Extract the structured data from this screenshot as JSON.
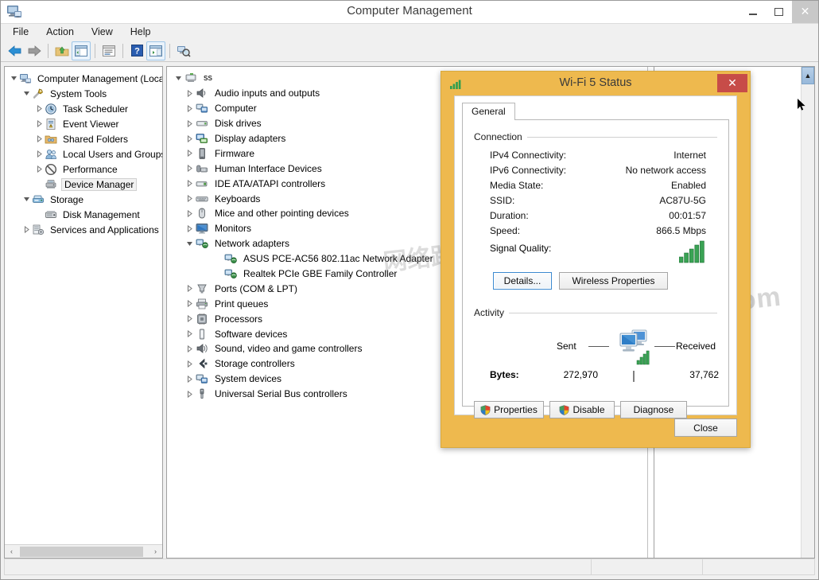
{
  "window": {
    "title": "Computer Management",
    "app_icon": "computer-management-icon",
    "controls": {
      "minimize": "–",
      "maximize": "☐",
      "close": "✕"
    }
  },
  "menubar": {
    "items": [
      "File",
      "Action",
      "View",
      "Help"
    ]
  },
  "toolbar": {
    "buttons": [
      {
        "name": "back-icon"
      },
      {
        "name": "forward-icon"
      },
      {
        "name": "up-folder-icon"
      },
      {
        "name": "show-console-tree-icon"
      },
      {
        "name": "properties-icon"
      },
      {
        "name": "help-icon"
      },
      {
        "name": "show-action-pane-icon"
      },
      {
        "name": "scan-hardware-changes-icon"
      }
    ]
  },
  "sidebar": {
    "items": [
      {
        "label": "Computer Management (Local",
        "indent": 0,
        "expander": "open",
        "icon": "computer-management-icon",
        "selected": false
      },
      {
        "label": "System Tools",
        "indent": 1,
        "expander": "open",
        "icon": "system-tools-icon",
        "selected": false
      },
      {
        "label": "Task Scheduler",
        "indent": 2,
        "expander": "closed",
        "icon": "clock-icon",
        "selected": false
      },
      {
        "label": "Event Viewer",
        "indent": 2,
        "expander": "closed",
        "icon": "event-viewer-icon",
        "selected": false
      },
      {
        "label": "Shared Folders",
        "indent": 2,
        "expander": "closed",
        "icon": "shared-folders-icon",
        "selected": false
      },
      {
        "label": "Local Users and Groups",
        "indent": 2,
        "expander": "closed",
        "icon": "users-icon",
        "selected": false
      },
      {
        "label": "Performance",
        "indent": 2,
        "expander": "closed",
        "icon": "performance-icon",
        "selected": false
      },
      {
        "label": "Device Manager",
        "indent": 2,
        "expander": "none",
        "icon": "device-manager-icon",
        "selected": true
      },
      {
        "label": "Storage",
        "indent": 1,
        "expander": "open",
        "icon": "storage-icon",
        "selected": false
      },
      {
        "label": "Disk Management",
        "indent": 2,
        "expander": "none",
        "icon": "disk-management-icon",
        "selected": false
      },
      {
        "label": "Services and Applications",
        "indent": 1,
        "expander": "closed",
        "icon": "services-icon",
        "selected": false
      }
    ]
  },
  "device_tree": {
    "root": {
      "label": "ss",
      "expander": "open",
      "icon": "computer-node-icon"
    },
    "items": [
      {
        "label": "Audio inputs and outputs",
        "level": 2,
        "expander": "closed",
        "icon": "audio-icon"
      },
      {
        "label": "Computer",
        "level": 2,
        "expander": "closed",
        "icon": "computer-icon"
      },
      {
        "label": "Disk drives",
        "level": 2,
        "expander": "closed",
        "icon": "disk-drive-icon"
      },
      {
        "label": "Display adapters",
        "level": 2,
        "expander": "closed",
        "icon": "display-adapter-icon"
      },
      {
        "label": "Firmware",
        "level": 2,
        "expander": "closed",
        "icon": "firmware-icon"
      },
      {
        "label": "Human Interface Devices",
        "level": 2,
        "expander": "closed",
        "icon": "hid-icon"
      },
      {
        "label": "IDE ATA/ATAPI controllers",
        "level": 2,
        "expander": "closed",
        "icon": "ide-controller-icon"
      },
      {
        "label": "Keyboards",
        "level": 2,
        "expander": "closed",
        "icon": "keyboard-icon"
      },
      {
        "label": "Mice and other pointing devices",
        "level": 2,
        "expander": "closed",
        "icon": "mouse-icon"
      },
      {
        "label": "Monitors",
        "level": 2,
        "expander": "closed",
        "icon": "monitor-icon"
      },
      {
        "label": "Network adapters",
        "level": 2,
        "expander": "open",
        "icon": "network-adapter-icon"
      },
      {
        "label": "ASUS PCE-AC56 802.11ac Network Adapter",
        "level": 3,
        "expander": "none",
        "icon": "network-adapter-icon"
      },
      {
        "label": "Realtek PCIe GBE Family Controller",
        "level": 3,
        "expander": "none",
        "icon": "network-adapter-icon"
      },
      {
        "label": "Ports (COM & LPT)",
        "level": 2,
        "expander": "closed",
        "icon": "port-icon"
      },
      {
        "label": "Print queues",
        "level": 2,
        "expander": "closed",
        "icon": "printer-icon"
      },
      {
        "label": "Processors",
        "level": 2,
        "expander": "closed",
        "icon": "processor-icon"
      },
      {
        "label": "Software devices",
        "level": 2,
        "expander": "closed",
        "icon": "software-device-icon"
      },
      {
        "label": "Sound, video and game controllers",
        "level": 2,
        "expander": "closed",
        "icon": "sound-icon"
      },
      {
        "label": "Storage controllers",
        "level": 2,
        "expander": "closed",
        "icon": "storage-controller-icon"
      },
      {
        "label": "System devices",
        "level": 2,
        "expander": "closed",
        "icon": "system-device-icon"
      },
      {
        "label": "Universal Serial Bus controllers",
        "level": 2,
        "expander": "closed",
        "icon": "usb-icon"
      }
    ]
  },
  "dialog": {
    "title": "Wi-Fi 5 Status",
    "icon": "wifi-signal-icon",
    "close_glyph": "✕",
    "tab": "General",
    "connection": {
      "group_label": "Connection",
      "rows": [
        {
          "key": "IPv4 Connectivity:",
          "value": "Internet"
        },
        {
          "key": "IPv6 Connectivity:",
          "value": "No network access"
        },
        {
          "key": "Media State:",
          "value": "Enabled"
        },
        {
          "key": "SSID:",
          "value": "AC87U-5G"
        },
        {
          "key": "Duration:",
          "value": "00:01:57"
        },
        {
          "key": "Speed:",
          "value": "866.5 Mbps"
        }
      ],
      "signal_quality_label": "Signal Quality:",
      "signal_bars": 5,
      "buttons": [
        {
          "label": "Details...",
          "focused": true
        },
        {
          "label": "Wireless Properties",
          "focused": false
        }
      ]
    },
    "activity": {
      "group_label": "Activity",
      "sent_label": "Sent",
      "received_label": "Received",
      "bytes_label": "Bytes:",
      "bytes_sent": "272,970",
      "bytes_received": "37,762",
      "center_icon": "two-computers-icon"
    },
    "action_buttons": [
      {
        "label": "Properties",
        "icon": "uac-shield-icon"
      },
      {
        "label": "Disable",
        "icon": "uac-shield-icon"
      },
      {
        "label": "Diagnose",
        "icon": null
      }
    ],
    "close_button": "Close"
  },
  "right_pane": {
    "scroll_up_glyph": "▲",
    "cursor": "arrow-cursor"
  },
  "left_scroll": {
    "left_glyph": "‹",
    "right_glyph": "›"
  },
  "watermarks": [
    "www.fansgu.com",
    "网络路由爱好者论坛"
  ],
  "colors": {
    "dialog_frame": "#eeb94e",
    "dialog_close": "#c74c48",
    "tree_selection": "#f2f2f2",
    "focus_border": "#3c8ad0",
    "signal_green": "#33a14b",
    "scroll_highlight": "#a8c6e2"
  }
}
